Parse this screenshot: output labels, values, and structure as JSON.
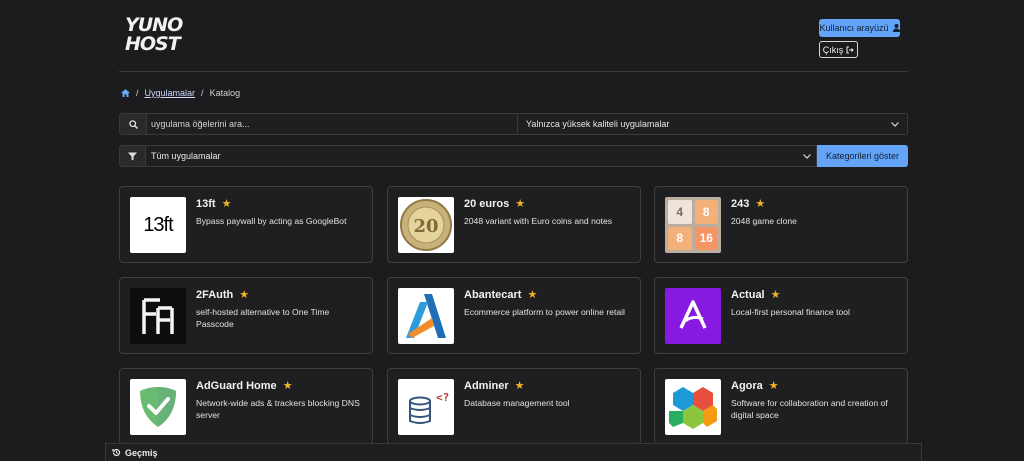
{
  "header": {
    "logo_line1": "YUNO",
    "logo_line2": "HOST",
    "interface_button": "Kullanıcı arayüzü",
    "logout_button": "Çıkış"
  },
  "breadcrumb": {
    "home_icon": "home-icon",
    "apps_link": "Uygulamalar",
    "current": "Katalog",
    "separator": "/"
  },
  "search": {
    "placeholder": "uygulama öğelerini ara...",
    "quality_select": "Yalnızca yüksek kaliteli uygulamalar"
  },
  "filter": {
    "category_select": "Tüm uygulamalar",
    "show_categories_button": "Kategorileri göster"
  },
  "apps": [
    {
      "name": "13ft",
      "description": "Bypass paywall by acting as GoogleBot",
      "thumb_label": "13ft"
    },
    {
      "name": "20 euros",
      "description": "2048 variant with Euro coins and notes",
      "thumb_label": "20"
    },
    {
      "name": "243",
      "description": "2048 game clone",
      "thumb_tiles": [
        "4",
        "8",
        "8",
        "16"
      ]
    },
    {
      "name": "2FAuth",
      "description": "self-hosted alternative to One Time Passcode"
    },
    {
      "name": "Abantecart",
      "description": "Ecommerce platform to power online retail"
    },
    {
      "name": "Actual",
      "description": "Local-first personal finance tool"
    },
    {
      "name": "AdGuard Home",
      "description": "Network-wide ads & trackers blocking DNS server"
    },
    {
      "name": "Adminer",
      "description": "Database management tool"
    },
    {
      "name": "Agora",
      "description": "Software for collaboration and creation of digital space"
    }
  ],
  "history": {
    "label": "Geçmiş"
  },
  "colors": {
    "accent": "#63a4f8",
    "star": "#f0b429",
    "background": "#1c1c1e"
  }
}
